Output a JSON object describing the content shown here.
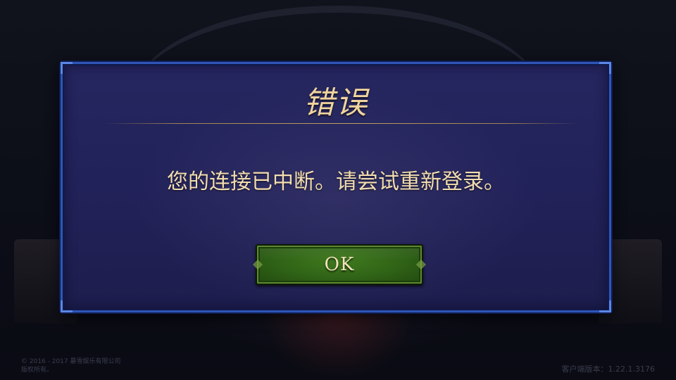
{
  "dialog": {
    "title": "错误",
    "message": "您的连接已中断。请尝试重新登录。",
    "ok_label": "OK"
  },
  "footer": {
    "copyright_line1": "© 2016 - 2017 暴雪娱乐有限公司",
    "copyright_line2": "版权所有。",
    "client_version_label": "客户端版本：",
    "client_version": "1.22.1.3176"
  },
  "colors": {
    "dialog_border": "#2f56b8",
    "dialog_bg": "#22225a",
    "title_text": "#f0d49c",
    "message_text": "#f2dcae",
    "button_green": "#2f6216"
  }
}
